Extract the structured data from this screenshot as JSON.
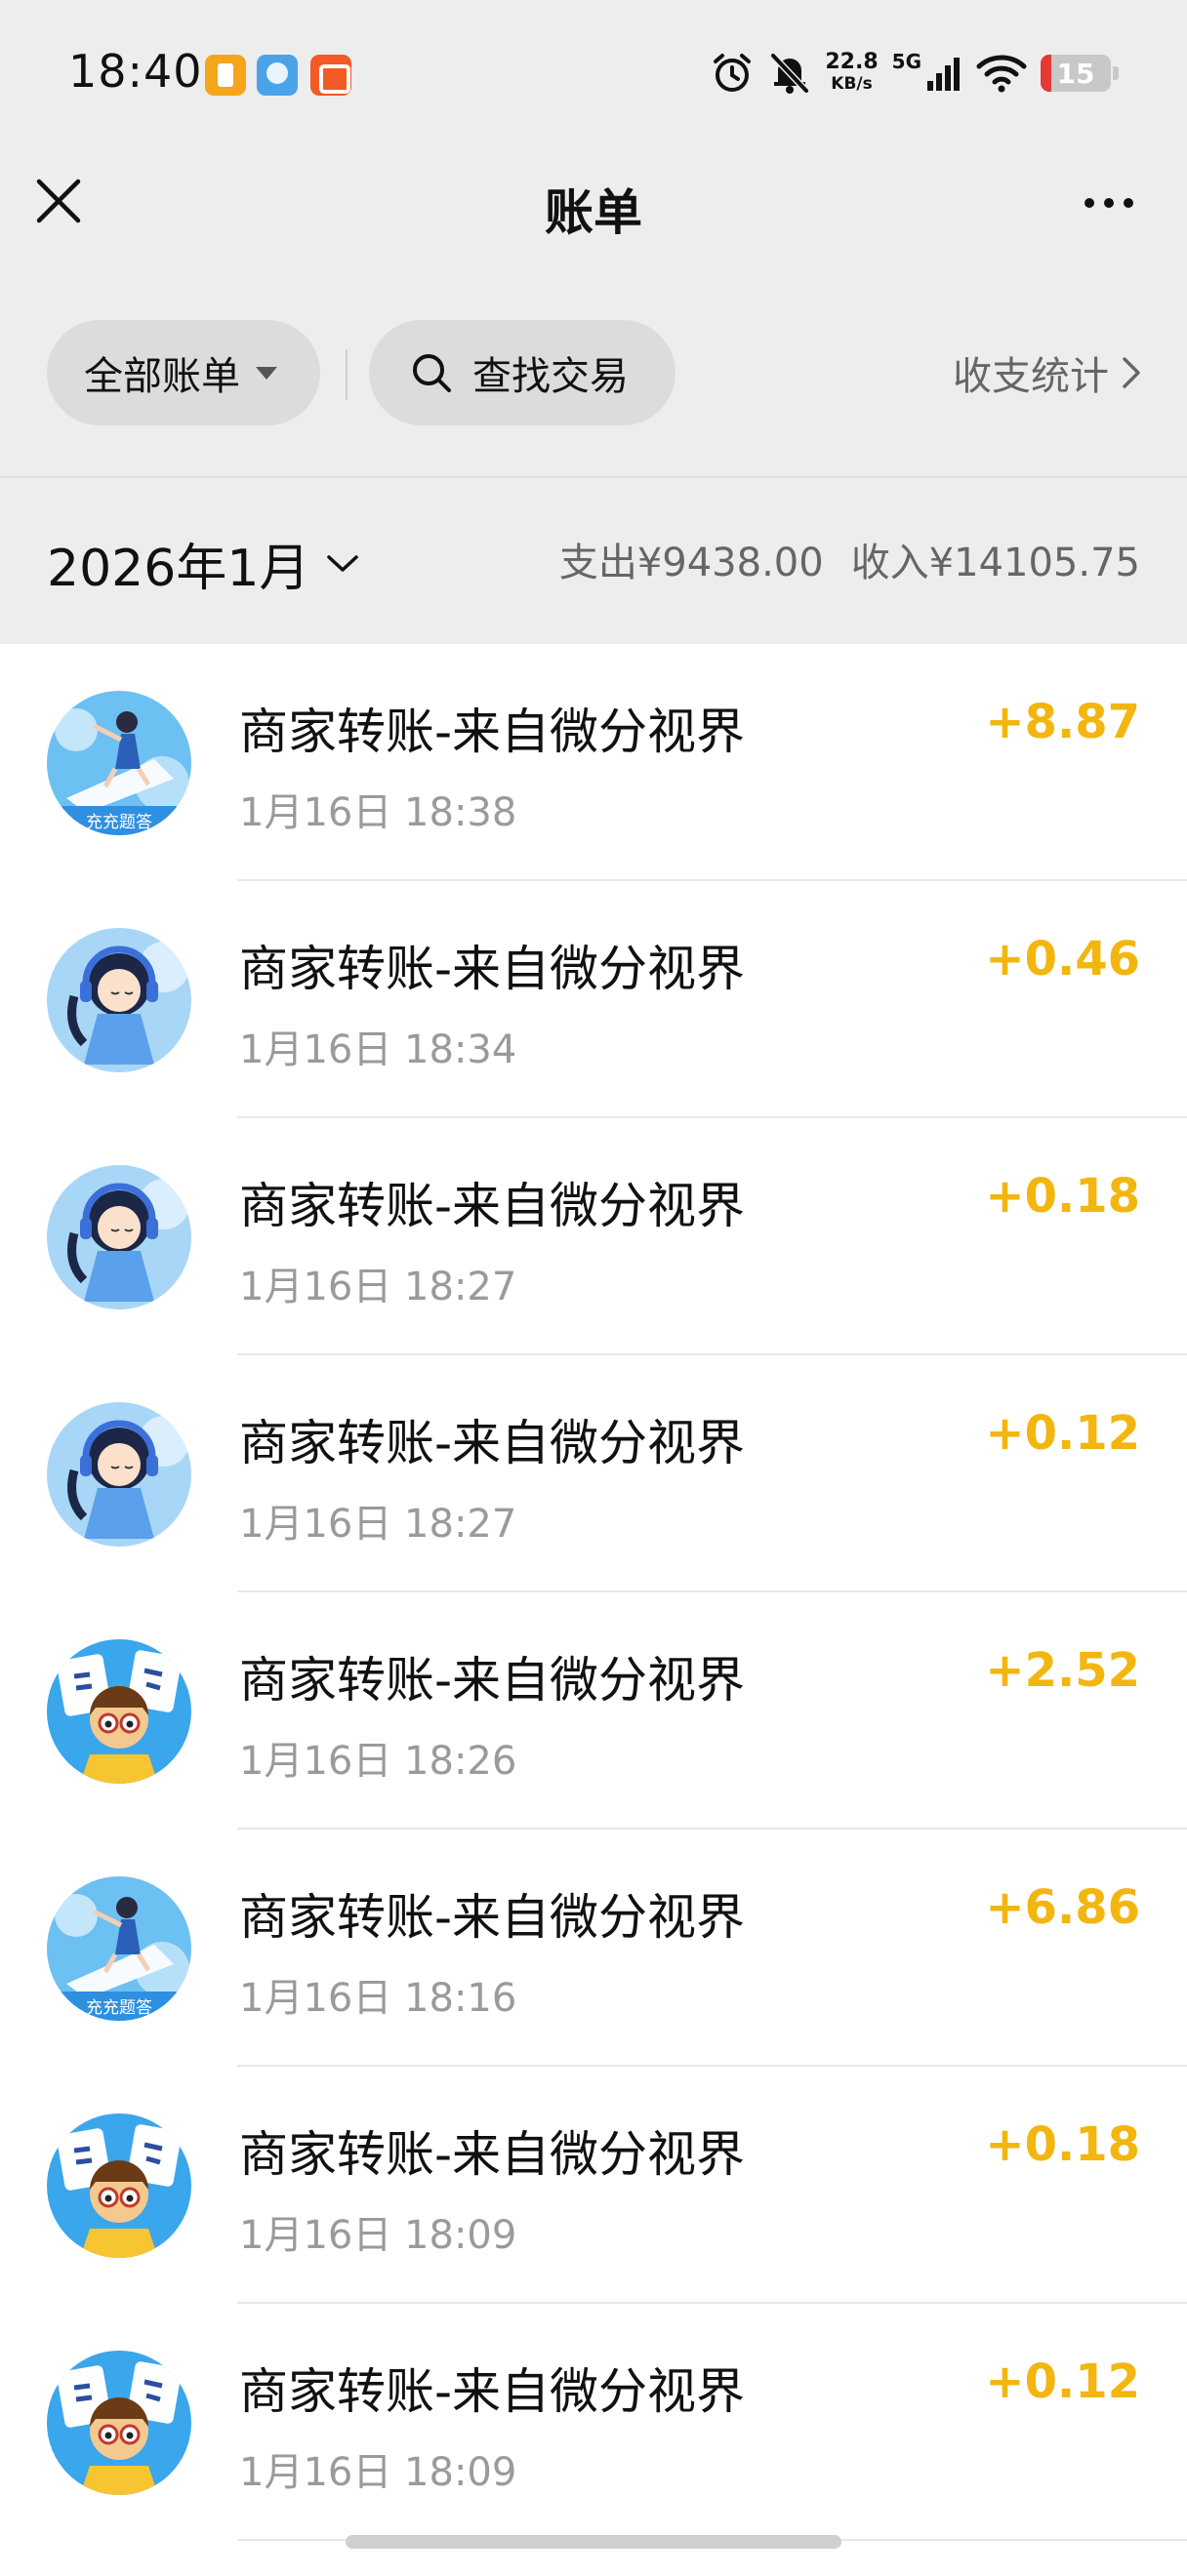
{
  "status_bar": {
    "time": "18:40",
    "app_icons": [
      "notes-app-icon",
      "browser-app-icon",
      "video-app-icon"
    ],
    "net_speed_value": "22.8",
    "net_speed_unit": "KB/s",
    "network": "5G",
    "battery": "15",
    "icons": [
      "alarm-icon",
      "mute-bell-icon",
      "signal-icon",
      "wifi-icon",
      "battery-icon"
    ]
  },
  "header": {
    "title": "账单",
    "close_icon": "close-icon",
    "more_icon": "more-dots-icon"
  },
  "filters": {
    "all_bills": "全部账单",
    "search": "查找交易",
    "stats": "收支统计"
  },
  "month": {
    "label": "2026年1月",
    "expense": "支出¥9438.00",
    "income": "收入¥14105.75"
  },
  "transactions": [
    {
      "title": "商家转账-来自微分视界",
      "time": "1月16日 18:38",
      "amount": "+8.87",
      "avatar": "sky-reader-avatar",
      "badge": "充充题答"
    },
    {
      "title": "商家转账-来自微分视界",
      "time": "1月16日 18:34",
      "amount": "+0.46",
      "avatar": "headphone-girl-avatar",
      "badge": ""
    },
    {
      "title": "商家转账-来自微分视界",
      "time": "1月16日 18:27",
      "amount": "+0.18",
      "avatar": "headphone-girl-avatar",
      "badge": ""
    },
    {
      "title": "商家转账-来自微分视界",
      "time": "1月16日 18:27",
      "amount": "+0.12",
      "avatar": "headphone-girl-avatar",
      "badge": ""
    },
    {
      "title": "商家转账-来自微分视界",
      "time": "1月16日 18:26",
      "amount": "+2.52",
      "avatar": "character-cards-avatar",
      "badge": ""
    },
    {
      "title": "商家转账-来自微分视界",
      "time": "1月16日 18:16",
      "amount": "+6.86",
      "avatar": "sky-reader-avatar",
      "badge": "充充题答"
    },
    {
      "title": "商家转账-来自微分视界",
      "time": "1月16日 18:09",
      "amount": "+0.18",
      "avatar": "character-cards-avatar",
      "badge": ""
    },
    {
      "title": "商家转账-来自微分视界",
      "time": "1月16日 18:09",
      "amount": "+0.12",
      "avatar": "character-cards-avatar",
      "badge": ""
    }
  ],
  "colors": {
    "income_amount": "#f2b60f",
    "page_header_bg": "#ededed",
    "pill_bg": "#dcdcdc",
    "secondary_text": "#9a9a9a"
  }
}
